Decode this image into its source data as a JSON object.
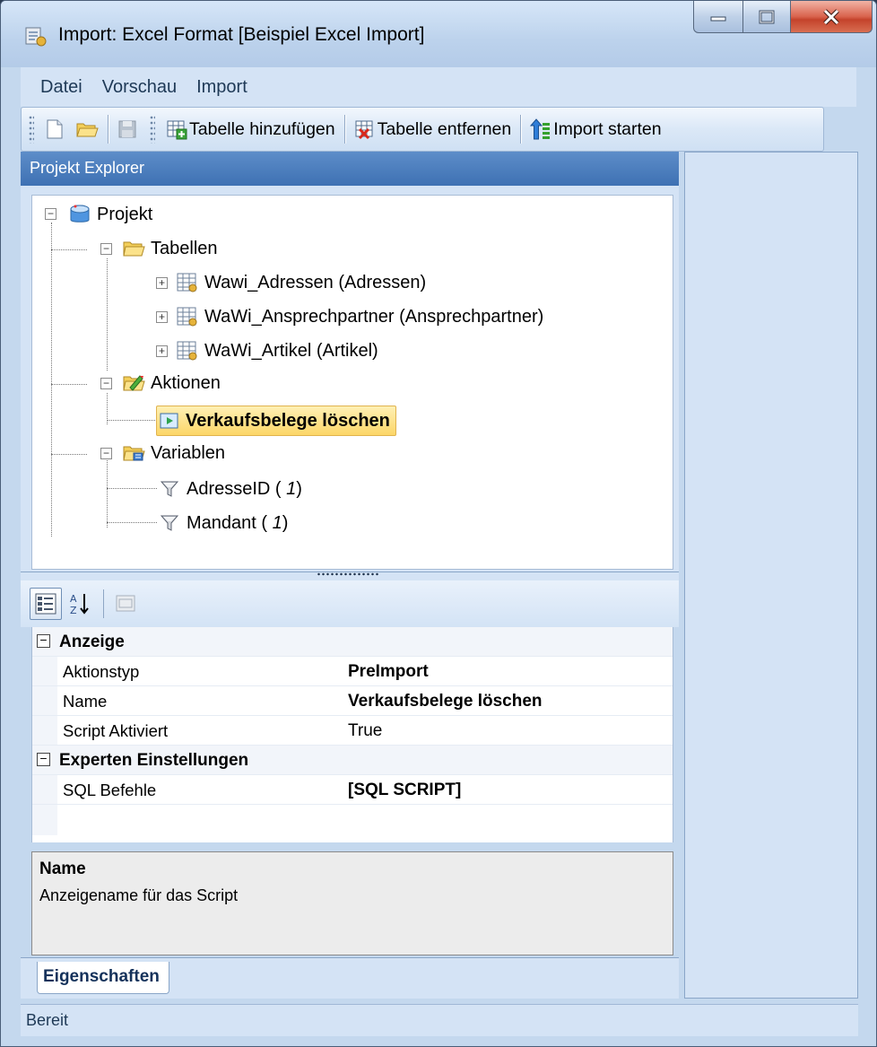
{
  "window": {
    "title": "Import: Excel Format [Beispiel Excel Import]"
  },
  "menu": [
    "Datei",
    "Vorschau",
    "Import"
  ],
  "toolbar": {
    "add_table": "Tabelle hinzufügen",
    "remove_table": "Tabelle entfernen",
    "start_import": "Import starten"
  },
  "explorer": {
    "header": "Projekt Explorer",
    "root": "Projekt",
    "tables_folder": "Tabellen",
    "tables": [
      "Wawi_Adressen (Adressen)",
      "WaWi_Ansprechpartner (Ansprechpartner)",
      "WaWi_Artikel (Artikel)"
    ],
    "actions_folder": "Aktionen",
    "actions": [
      "Verkaufsbelege löschen"
    ],
    "variables_folder": "Variablen",
    "variables": [
      {
        "name": "AdresseID",
        "value": "1"
      },
      {
        "name": "Mandant",
        "value": "1"
      }
    ]
  },
  "properties": {
    "categories": [
      {
        "label": "Anzeige",
        "rows": [
          {
            "name": "Aktionstyp",
            "value": "PreImport"
          },
          {
            "name": "Name",
            "value": "Verkaufsbelege löschen"
          },
          {
            "name": "Script Aktiviert",
            "value": "True"
          }
        ]
      },
      {
        "label": "Experten Einstellungen",
        "rows": [
          {
            "name": "SQL Befehle",
            "value": "[SQL SCRIPT]"
          }
        ]
      }
    ],
    "description_title": "Name",
    "description_text": "Anzeigename für das Script",
    "tab": "Eigenschaften"
  },
  "status": "Bereit"
}
